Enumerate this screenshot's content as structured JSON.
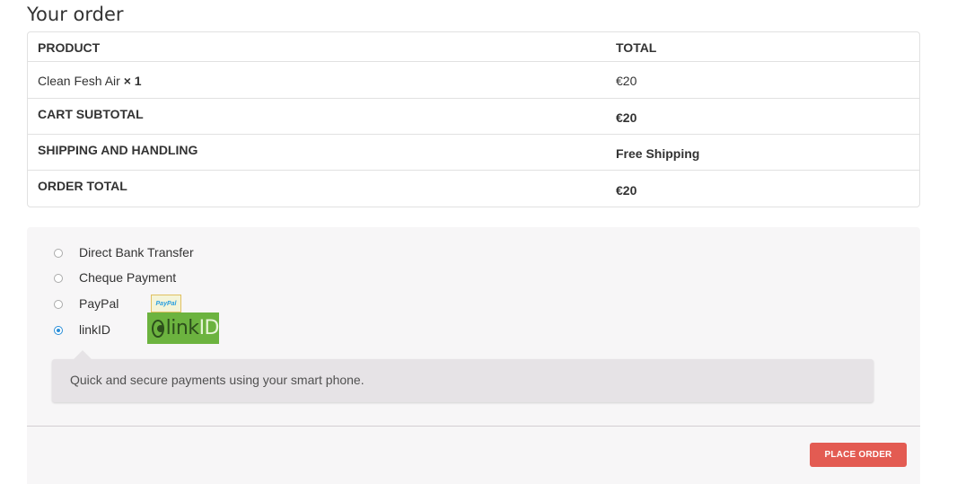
{
  "heading": "Your order",
  "table": {
    "headers": {
      "product": "PRODUCT",
      "total": "TOTAL"
    },
    "item": {
      "name": "Clean Fesh Air",
      "qty": "× 1",
      "total": "€20"
    },
    "subtotal": {
      "label": "CART SUBTOTAL",
      "value": "€20"
    },
    "shipping": {
      "label": "SHIPPING AND HANDLING",
      "value": "Free Shipping"
    },
    "order_total": {
      "label": "ORDER TOTAL",
      "value": "€20"
    }
  },
  "payment": {
    "methods": [
      {
        "label": "Direct Bank Transfer",
        "selected": false
      },
      {
        "label": "Cheque Payment",
        "selected": false
      },
      {
        "label": "PayPal",
        "selected": false,
        "logo": "paypal-logo",
        "logo_text": "PayPal"
      },
      {
        "label": "linkID",
        "selected": true,
        "logo": "linkid-logo",
        "logo_text_link": "link",
        "logo_text_id": "ID"
      }
    ],
    "selected_description": "Quick and secure payments using your smart phone.",
    "place_order_label": "PLACE ORDER"
  },
  "colors": {
    "accent_button": "#e35b52",
    "radio_selected": "#2a8ed8",
    "panel_bg": "#f7f6f7",
    "linkid_green": "#6cb33f"
  }
}
